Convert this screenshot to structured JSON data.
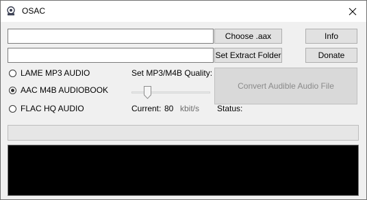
{
  "window": {
    "title": "OSAC",
    "app_icon": "osac-app-icon",
    "close_icon": "close-icon"
  },
  "inputs": {
    "aax_path": {
      "value": "",
      "placeholder": ""
    },
    "extract_folder": {
      "value": "",
      "placeholder": ""
    }
  },
  "buttons": {
    "choose_aax": "Choose .aax",
    "set_extract_folder": "Set Extract Folder",
    "info": "Info",
    "donate": "Donate",
    "convert": "Convert Audible Audio File"
  },
  "formats": [
    {
      "label": "LAME MP3 AUDIO",
      "checked": false
    },
    {
      "label": "AAC M4B AUDIOBOOK",
      "checked": true
    },
    {
      "label": "FLAC HQ AUDIO",
      "checked": false
    }
  ],
  "quality": {
    "label": "Set MP3/M4B Quality:",
    "current_label": "Current:",
    "current_value": "80",
    "unit": "kbit/s",
    "slider_fraction": 0.17
  },
  "status": {
    "label": "Status:",
    "value": ""
  },
  "progress": {
    "fraction": 0
  },
  "console": {
    "text": ""
  },
  "colors": {
    "console_bg": "#000000",
    "window_bg": "#f0f0f0",
    "progress_fill": "#06b025"
  }
}
